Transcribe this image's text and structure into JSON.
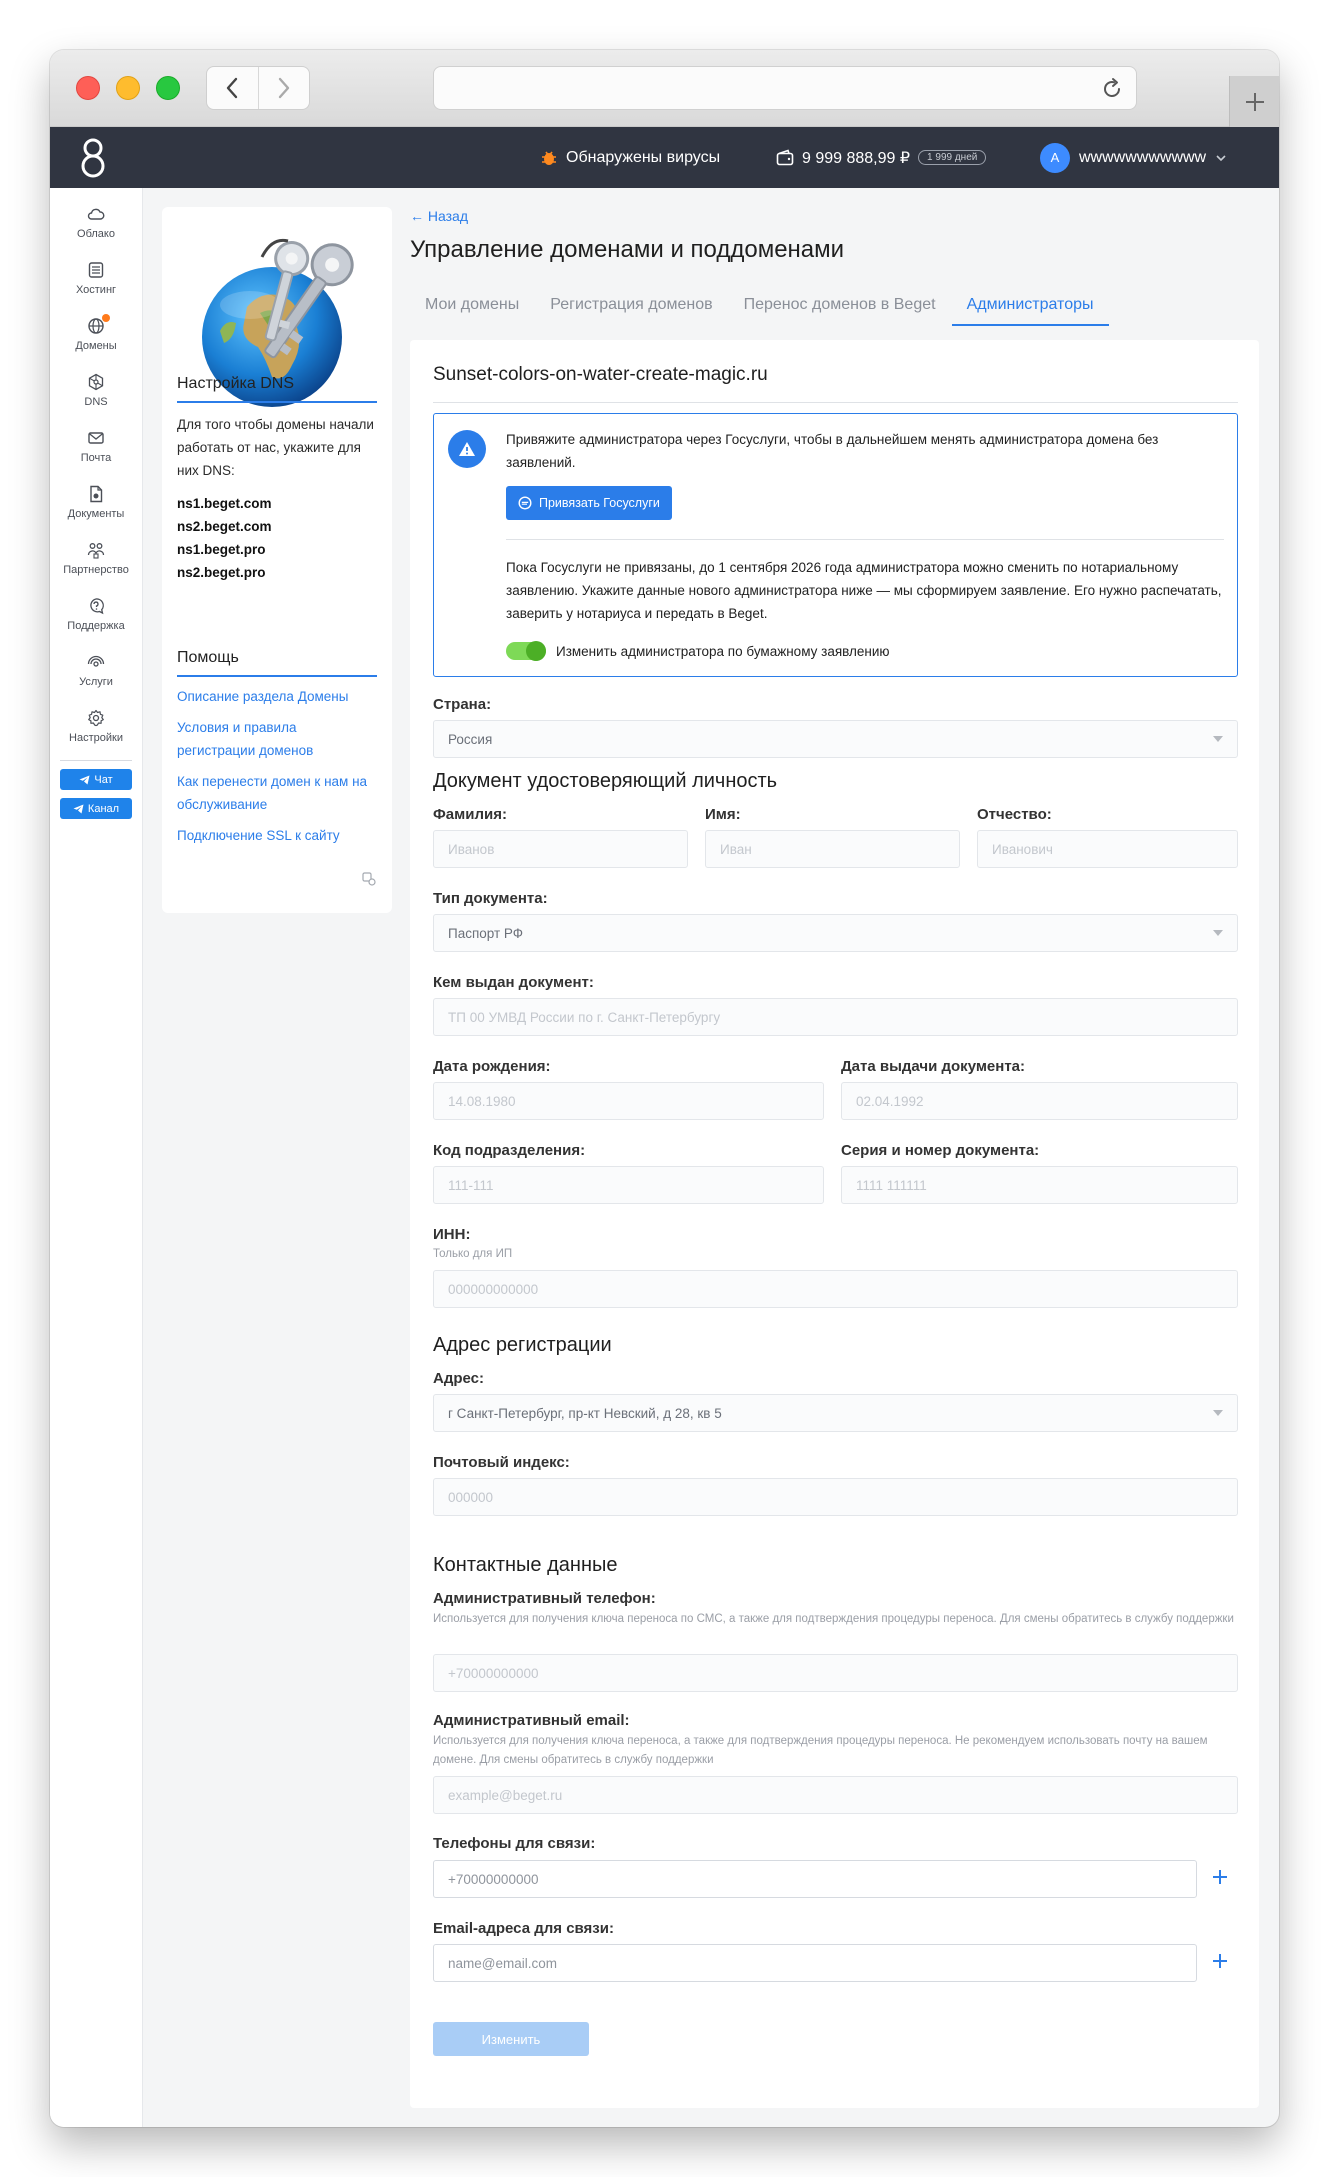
{
  "app": {
    "virus_alert": "Обнаружены вирусы",
    "balance": "9 999 888,99 ₽",
    "balance_days": "1 999 дней",
    "username": "wwwwwwwwwww",
    "avatar_letter": "A"
  },
  "sidebar": {
    "items": [
      {
        "label": "Облако",
        "icon": "cloud-icon"
      },
      {
        "label": "Хостинг",
        "icon": "server-icon"
      },
      {
        "label": "Домены",
        "icon": "globe-icon"
      },
      {
        "label": "DNS",
        "icon": "dns-icon"
      },
      {
        "label": "Почта",
        "icon": "mail-icon"
      },
      {
        "label": "Документы",
        "icon": "document-icon"
      },
      {
        "label": "Партнерство",
        "icon": "partners-icon"
      },
      {
        "label": "Поддержка",
        "icon": "support-icon"
      },
      {
        "label": "Услуги",
        "icon": "services-icon"
      },
      {
        "label": "Настройки",
        "icon": "gear-icon"
      }
    ],
    "chat_label": "Чат",
    "channel_label": "Канал"
  },
  "left_panel": {
    "dns_title": "Настройка DNS",
    "dns_text": "Для того чтобы домены начали работать от нас, укажите для них DNS:",
    "dns_servers": [
      "ns1.beget.com",
      "ns2.beget.com",
      "ns1.beget.pro",
      "ns2.beget.pro"
    ],
    "help_title": "Помощь",
    "help_links": [
      "Описание раздела Домены",
      "Условия и правила регистрации доменов",
      "Как перенести домен к нам на обслуживание",
      "Подключение SSL к сайту"
    ]
  },
  "main": {
    "back_label": "← Назад",
    "title": "Управление доменами и поддоменами",
    "tabs": [
      {
        "label": "Мои домены",
        "active": false
      },
      {
        "label": "Регистрация доменов",
        "active": false
      },
      {
        "label": "Перенос доменов в Beget",
        "active": false
      },
      {
        "label": "Администраторы",
        "active": true
      }
    ]
  },
  "card": {
    "domain": "Sunset-colors-on-water-create-magic.ru",
    "notice": {
      "text1": "Привяжите администратора через Госуслуги, чтобы в дальнейшем менять администратора домена без заявлений.",
      "button": "Привязать Госуслуги",
      "text2": "Пока Госуслуги не привязаны, до 1 сентября 2026 года администратора можно сменить по нотариальному заявлению. Укажите данные нового администратора ниже — мы сформируем заявление. Его нужно распечатать, заверить у нотариуса и передать в Beget.",
      "toggle_label": "Изменить администратора по бумажному заявлению",
      "toggle_on": true
    },
    "country_label": "Страна:",
    "country_value": "Россия",
    "identity_title": "Документ удостоверяющий личность",
    "last_name_label": "Фамилия:",
    "last_name_ph": "Иванов",
    "first_name_label": "Имя:",
    "first_name_ph": "Иван",
    "middle_name_label": "Отчество:",
    "middle_name_ph": "Иванович",
    "doc_type_label": "Тип документа:",
    "doc_type_value": "Паспорт РФ",
    "issued_by_label": "Кем выдан документ:",
    "issued_by_ph": "ТП 00 УМВД России по г. Санкт-Петербургу",
    "birth_label": "Дата рождения:",
    "birth_ph": "14.08.1980",
    "issue_date_label": "Дата выдачи документа:",
    "issue_date_ph": "02.04.1992",
    "division_label": "Код подразделения:",
    "division_ph": "111-111",
    "series_label": "Серия и номер документа:",
    "series_ph": "1111 111111",
    "inn_label": "ИНН:",
    "inn_hint": "Только для ИП",
    "inn_ph": "000000000000",
    "address_title": "Адрес регистрации",
    "address_label": "Адрес:",
    "address_value": "г Санкт-Петербург, пр-кт Невский, д 28, кв 5",
    "zip_label": "Почтовый индекс:",
    "zip_ph": "000000",
    "contacts_title": "Контактные данные",
    "admin_phone_label": "Административный телефон:",
    "admin_phone_hint": "Используется для получения ключа переноса по СМС, а также для подтверждения процедуры переноса. Для смены обратитесь в службу поддержки",
    "admin_phone_ph": "+70000000000",
    "admin_email_label": "Административный email:",
    "admin_email_hint": "Используется для получения ключа переноса, а также для подтверждения процедуры переноса. Не рекомендуем использовать почту на вашем домене. Для смены обратитесь в службу поддержки",
    "admin_email_ph": "example@beget.ru",
    "phones_label": "Телефоны для связи:",
    "phones_ph": "+70000000000",
    "emails_label": "Email-адреса для связи:",
    "emails_ph": "name@email.com",
    "submit": "Изменить"
  }
}
